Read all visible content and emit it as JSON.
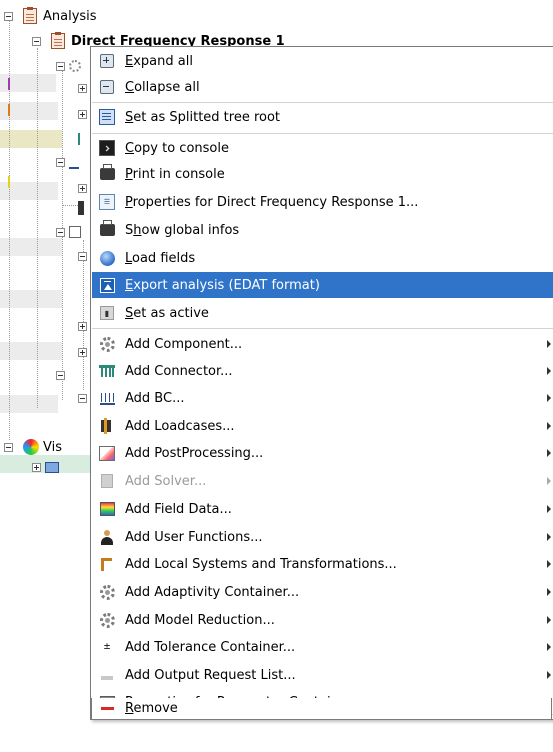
{
  "tree": {
    "analysis_label": "Analysis",
    "dfr_label": "Direct Frequency Response 1",
    "vis_label": "Vis"
  },
  "colors": {
    "menu_highlight": "#2f74c9",
    "menu_border": "#7a7a7a",
    "disabled_text": "#9a9a9a"
  },
  "menu": {
    "items": [
      {
        "label": "Expand all",
        "mnemonic": "E",
        "rest": "xpand all",
        "icon": "expand-all-icon"
      },
      {
        "label": "Collapse all",
        "mnemonic": "C",
        "rest": "ollapse all",
        "icon": "collapse-all-icon"
      },
      {
        "label": "Set as Splitted tree root",
        "mnemonic": "S",
        "rest": "et as Splitted tree root",
        "icon": "split-tree-icon"
      },
      {
        "label": "Copy to console",
        "mnemonic": "C",
        "rest": "opy to console",
        "icon": "console-icon"
      },
      {
        "label": "Print in console",
        "mnemonic": "P",
        "rest": "rint in console",
        "icon": "printer-icon"
      },
      {
        "label": "Properties for Direct Frequency Response 1...",
        "mnemonic": "P",
        "rest": "roperties for Direct Frequency Response 1...",
        "icon": "properties-icon"
      },
      {
        "label": "Show global infos",
        "mnemonic_prefix": "S",
        "mnemonic": "h",
        "rest": "ow global infos",
        "icon": "printer-icon"
      },
      {
        "label": "Load fields",
        "mnemonic": "L",
        "rest": "oad fields",
        "icon": "globe-icon"
      },
      {
        "label": "Export analysis (EDAT format)",
        "mnemonic": "E",
        "rest": "xport analysis (EDAT format)",
        "icon": "export-icon"
      },
      {
        "label": "Set as active",
        "mnemonic": "S",
        "rest": "et as active",
        "icon": "set-active-icon"
      },
      {
        "label": "Add Component...",
        "icon": "gear-icon"
      },
      {
        "label": "Add Connector...",
        "icon": "connector-icon"
      },
      {
        "label": "Add BC...",
        "icon": "bc-icon"
      },
      {
        "label": "Add Loadcases...",
        "icon": "loadcases-icon"
      },
      {
        "label": "Add PostProcessing...",
        "icon": "postprocessing-icon"
      },
      {
        "label": "Add Solver...",
        "icon": "solver-icon"
      },
      {
        "label": "Add Field Data...",
        "icon": "field-data-icon"
      },
      {
        "label": "Add User Functions...",
        "icon": "user-icon"
      },
      {
        "label": "Add Local Systems and Transformations...",
        "icon": "local-systems-icon"
      },
      {
        "label": "Add Adaptivity Container...",
        "icon": "gear-icon"
      },
      {
        "label": "Add Model Reduction...",
        "icon": "gear-icon"
      },
      {
        "label": "Add Tolerance Container...",
        "icon": "tolerance-icon"
      },
      {
        "label": "Add Output Request List...",
        "icon": "output-request-icon"
      },
      {
        "label": "Properties for Parameter Container...",
        "mnemonic": "P",
        "rest": "roperties for Parameter Container...",
        "icon": "parameter-properties-icon"
      },
      {
        "label": "Remove",
        "mnemonic": "R",
        "rest": "emove",
        "icon": "remove-icon"
      }
    ],
    "active_item": "Export analysis (EDAT format)",
    "disabled_item": "Add Solver..."
  }
}
